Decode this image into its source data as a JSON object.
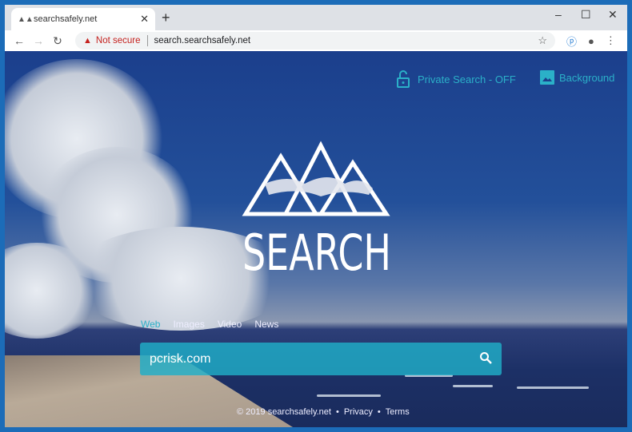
{
  "browser": {
    "tab_title": "searchsafely.net",
    "security_label": "Not secure",
    "url": "search.searchsafely.net",
    "icons": [
      "back-icon",
      "forward-icon",
      "reload-icon",
      "star-icon",
      "extension-icon",
      "profile-icon",
      "menu-icon"
    ]
  },
  "header": {
    "private_search": "Private Search - OFF",
    "background": "Background"
  },
  "logo": {
    "text": "SEARCH"
  },
  "search": {
    "tabs": [
      {
        "label": "Web",
        "active": true
      },
      {
        "label": "Images"
      },
      {
        "label": "Video"
      },
      {
        "label": "News"
      }
    ],
    "query": "pcrisk.com"
  },
  "footer": {
    "copyright": "© 2019 searchsafely.net",
    "privacy": "Privacy",
    "terms": "Terms",
    "separator": "•"
  },
  "colors": {
    "accent": "#2bb0c8",
    "warning": "#c5221f"
  }
}
